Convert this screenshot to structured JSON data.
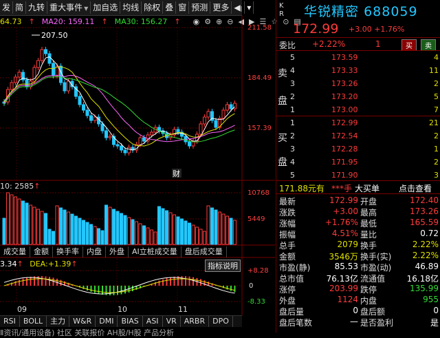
{
  "toolbar": {
    "items": [
      "发",
      "简",
      "九转",
      "重大事件",
      "加自选",
      "均线",
      "除权",
      "叠",
      "窗",
      "预测",
      "更多"
    ]
  },
  "ma_line": {
    "first_value": "64.73",
    "ma20": "MA20: 159.11",
    "ma30": "MA30: 156.27",
    "icons": [
      "eye-icon",
      "gear-icon",
      "plus-icon",
      "minus-icon",
      "back-icon",
      "forward-icon",
      "list-icon",
      "star-icon",
      "lock-icon",
      "doc-icon"
    ]
  },
  "price_axis": {
    "top": "211.58",
    "mid": "184.49",
    "low": "157.39"
  },
  "annotation_high": "207.50",
  "marker_cai": "财",
  "vol_panel": {
    "label_left": "10: 2585",
    "axis_top": "10768",
    "axis_mid": "5449",
    "tabs": [
      "成交量",
      "金额",
      "换手率",
      "内盘",
      "外盘",
      "AI立桩成交量",
      "盘后成交量"
    ]
  },
  "macd": {
    "diff": "3.34",
    "dea_label": "DEA:",
    "dea": "+1.39",
    "button": "指标说明",
    "axis_top": "+8.28",
    "axis_mid": "0",
    "axis_low": "-8.33"
  },
  "date_axis": [
    "09",
    "10",
    "11"
  ],
  "indicator_tabs": [
    "RSI",
    "BOLL",
    "主力",
    "W&R",
    "DMI",
    "BIAS",
    "ASI",
    "VR",
    "ARBR",
    "DPO"
  ],
  "bottom_subtabs": "Ⅱ资讯/通用设备)  社区  关联报价  AH股/H股  产品分析",
  "colors": {
    "up": "#ff3b3b",
    "down": "#22c7ff",
    "accent": "#e0e000",
    "name": "#22c7ff"
  },
  "quote": {
    "kr": [
      "K",
      "R"
    ],
    "name": "华锐精密",
    "code": "688059",
    "price": "172.99",
    "change": "+3.00",
    "change_pct": "+1.76%",
    "weibi_label": "委比",
    "weibi": "+2.22%",
    "weicha": "1",
    "buy_btn": "买",
    "sell_btn": "卖"
  },
  "asks": [
    {
      "lvl": "5",
      "px": "173.59",
      "vol": "4"
    },
    {
      "lvl": "4",
      "px": "173.33",
      "vol": "11"
    },
    {
      "lvl": "3",
      "px": "173.26",
      "vol": "2"
    },
    {
      "lvl": "2",
      "px": "173.20",
      "vol": "5"
    },
    {
      "lvl": "1",
      "px": "173.00",
      "vol": "7"
    }
  ],
  "bids": [
    {
      "lvl": "1",
      "px": "172.99",
      "vol": "21"
    },
    {
      "lvl": "2",
      "px": "172.54",
      "vol": "2"
    },
    {
      "lvl": "3",
      "px": "172.28",
      "vol": "1"
    },
    {
      "lvl": "4",
      "px": "171.95",
      "vol": "2"
    },
    {
      "lvl": "5",
      "px": "171.90",
      "vol": "3"
    }
  ],
  "big_order": {
    "price": "171.88元有",
    "unit": "***手",
    "label": "大买单",
    "link": "点击查看"
  },
  "stats": [
    {
      "l1": "最新",
      "v1": "172.99",
      "l2": "开盘",
      "v2": "172.40"
    },
    {
      "l1": "涨跌",
      "v1": "+3.00",
      "l2": "最高",
      "v2": "173.26"
    },
    {
      "l1": "涨幅",
      "v1": "+1.76%",
      "l2": "最低",
      "v2": "165.59"
    },
    {
      "l1": "振幅",
      "v1": "4.51%",
      "l2": "量比",
      "v2": "0.72"
    },
    {
      "l1": "总手",
      "v1": "2079",
      "l2": "换手",
      "v2": "2.22%"
    },
    {
      "l1": "金额",
      "v1": "3546万",
      "l2": "换手(实)",
      "v2": "2.22%"
    },
    {
      "l1": "市盈(静)",
      "v1": "85.53",
      "l2": "市盈(动)",
      "v2": "46.89"
    },
    {
      "l1": "总市值",
      "v1": "76.13亿",
      "l2": "流通值",
      "v2": "16.18亿"
    },
    {
      "l1": "涨停",
      "v1": "203.99",
      "l2": "跌停",
      "v2": "135.99"
    },
    {
      "l1": "外盘",
      "v1": "1124",
      "l2": "内盘",
      "v2": "955"
    },
    {
      "l1": "盘后量",
      "v1": "0",
      "l2": "盘后额",
      "v2": "0"
    },
    {
      "l1": "盘后笔数",
      "v1": "—",
      "l2": "是否盈利",
      "v2": "是"
    }
  ]
}
